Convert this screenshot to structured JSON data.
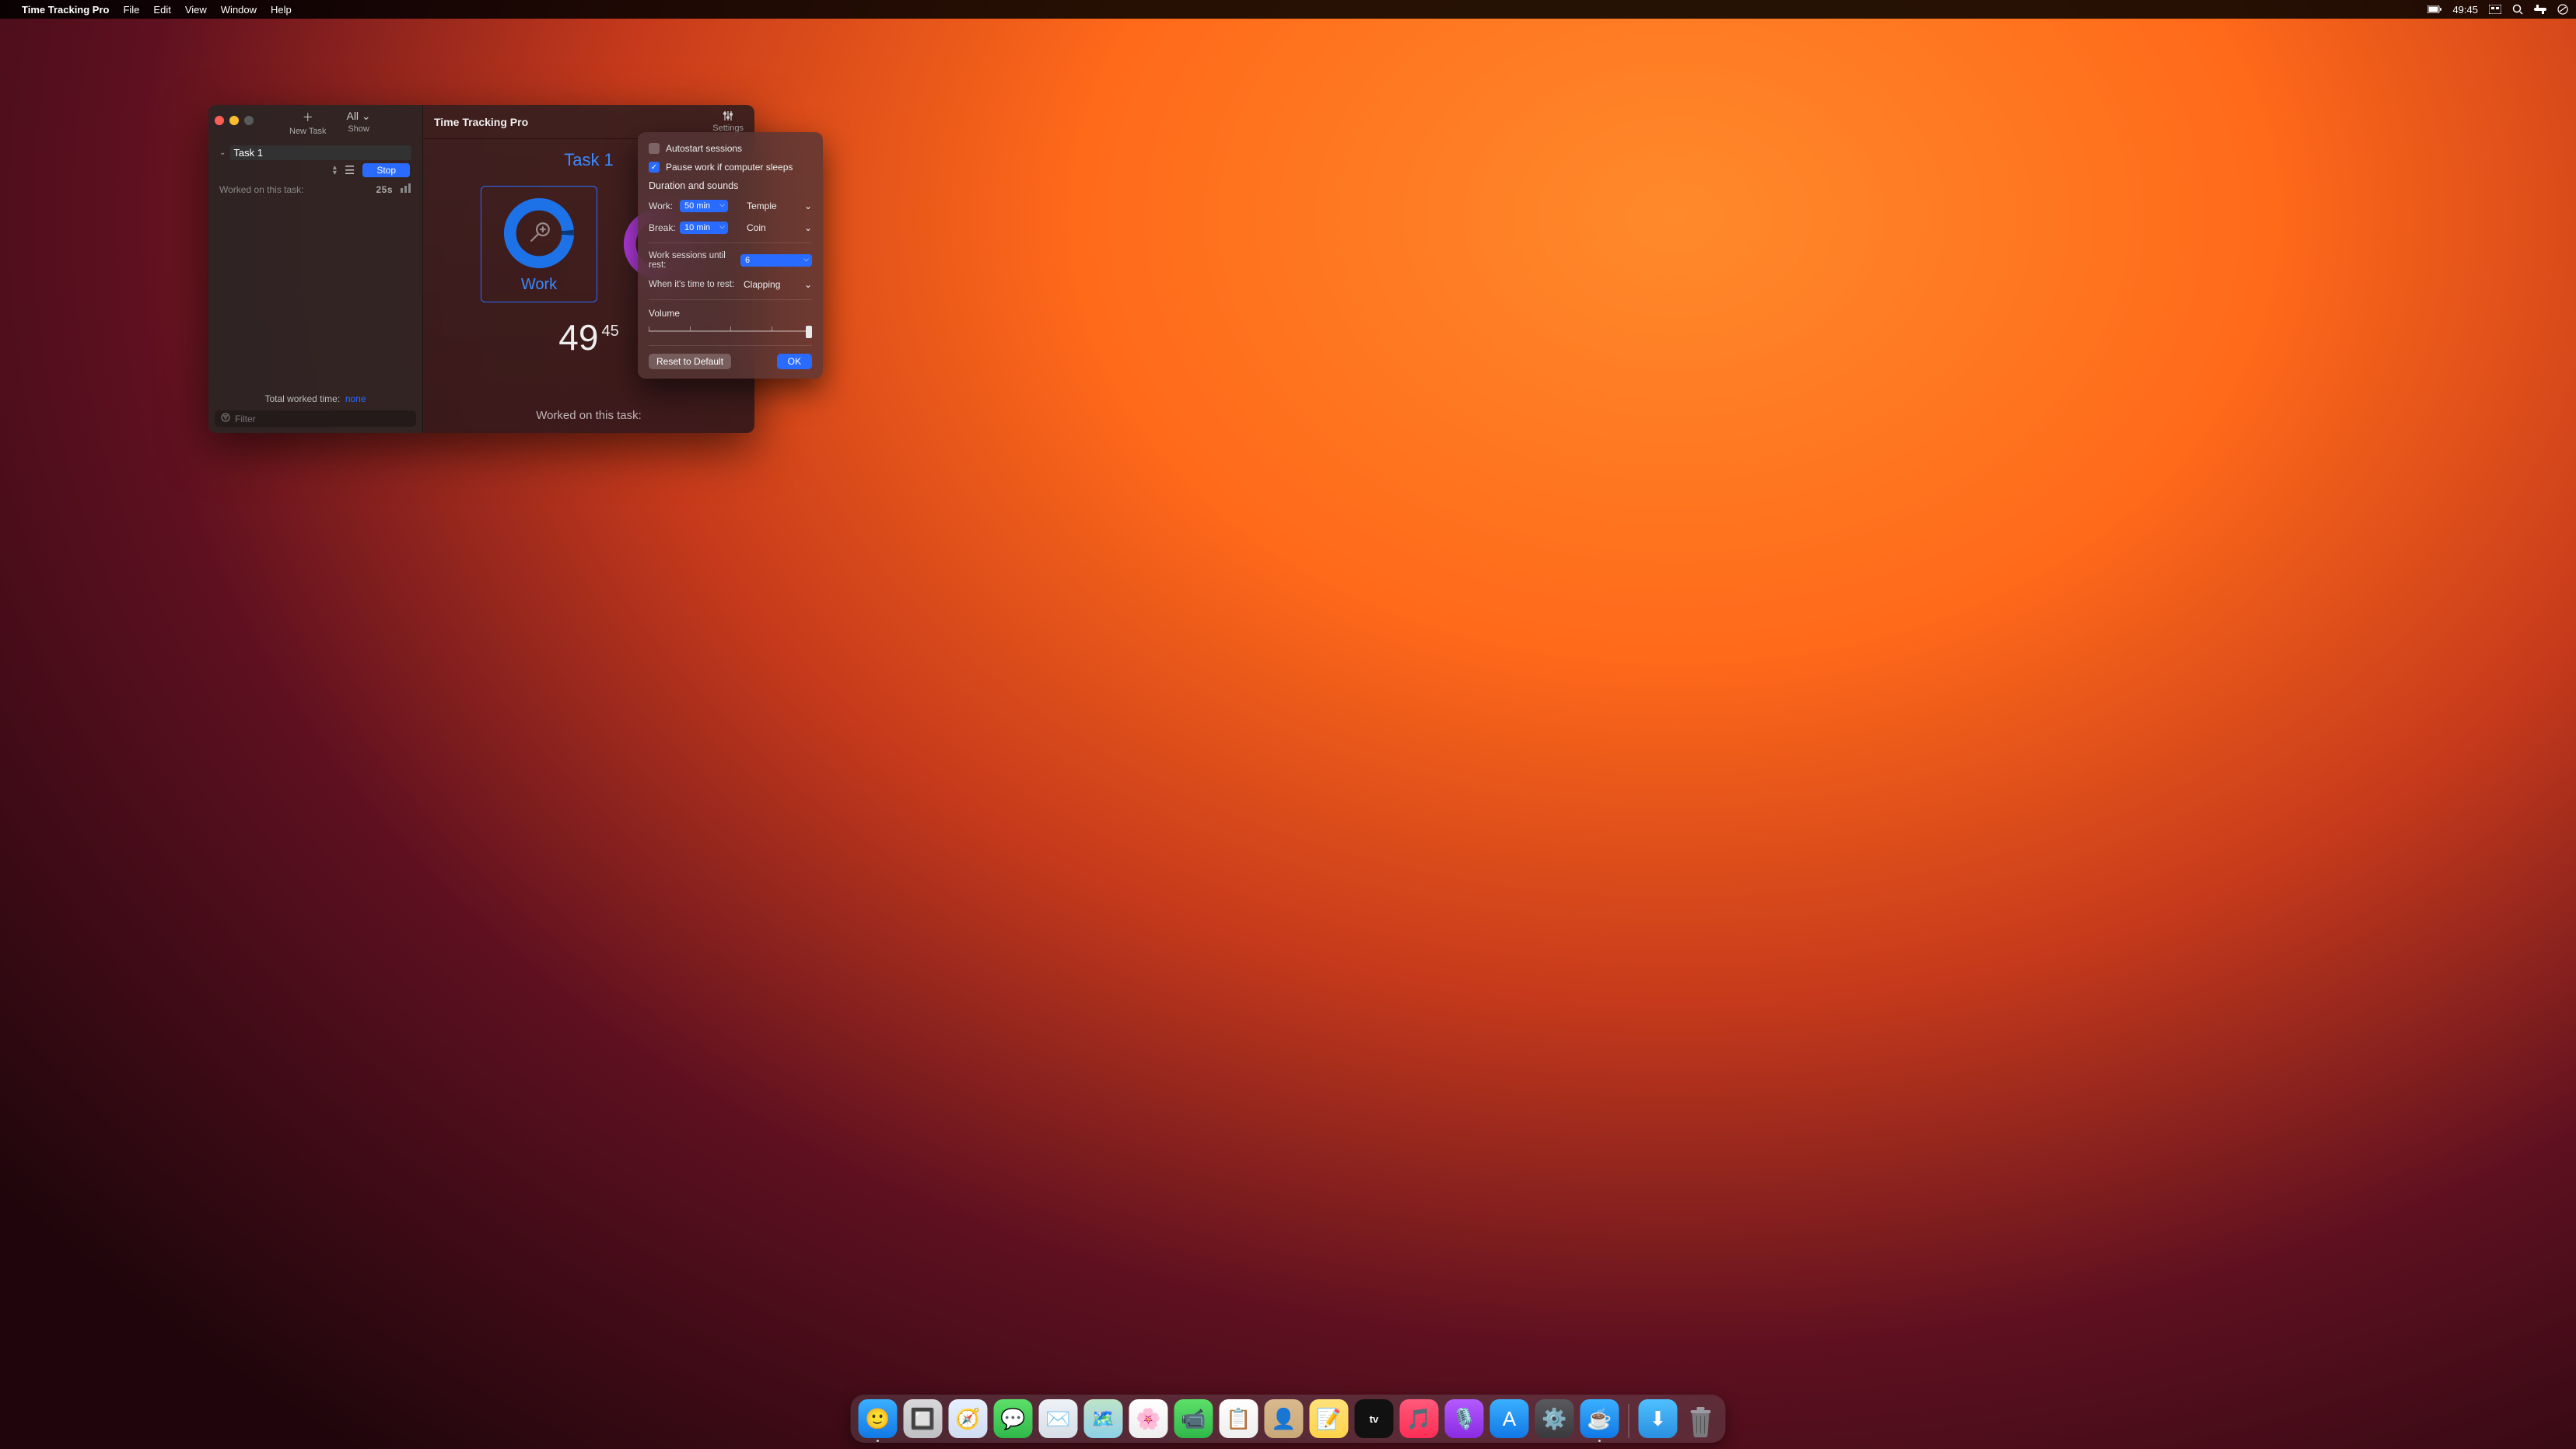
{
  "menubar": {
    "app": "Time Tracking Pro",
    "items": [
      "File",
      "Edit",
      "View",
      "Window",
      "Help"
    ],
    "clock": "49:45"
  },
  "window": {
    "toolbar": {
      "new_task_label": "New Task",
      "show_label": "Show",
      "show_value": "All"
    },
    "task": {
      "title": "Task 1",
      "stop_label": "Stop",
      "worked_prefix": "Worked on this task:",
      "worked_value": "25s"
    },
    "footer": {
      "total_prefix": "Total worked time:",
      "total_value": "none",
      "filter_placeholder": "Filter"
    },
    "detail": {
      "app_title": "Time Tracking Pro",
      "settings_label": "Settings",
      "task_heading": "Task 1",
      "ring_label": "Work",
      "timer_min": "49",
      "timer_sec": "45",
      "worked_line": "Worked on this task:"
    }
  },
  "popover": {
    "autostart_label": "Autostart sessions",
    "pause_label": "Pause work if computer sleeps",
    "pause_checked": true,
    "section": "Duration and sounds",
    "work_label": "Work:",
    "work_value": "50 min",
    "work_sound": "Temple",
    "break_label": "Break:",
    "break_value": "10 min",
    "break_sound": "Coin",
    "sessions_label": "Work sessions until rest:",
    "sessions_value": "6",
    "rest_label": "When it's time to rest:",
    "rest_value": "Clapping",
    "volume_label": "Volume",
    "reset_label": "Reset to Default",
    "ok_label": "OK"
  },
  "dock": {
    "apps": [
      {
        "name": "finder",
        "bg": "linear-gradient(#3ab0ff,#1178e6)",
        "glyph": "🙂"
      },
      {
        "name": "launchpad",
        "bg": "linear-gradient(#d8d8da,#bfbfc4)",
        "glyph": "🔲"
      },
      {
        "name": "safari",
        "bg": "linear-gradient(#e6f0ff,#d0dcf0)",
        "glyph": "🧭"
      },
      {
        "name": "messages",
        "bg": "linear-gradient(#5de06a,#2fb84a)",
        "glyph": "💬"
      },
      {
        "name": "mail",
        "bg": "linear-gradient(#eef2f7,#d6dde6)",
        "glyph": "✉️"
      },
      {
        "name": "maps",
        "bg": "linear-gradient(#bfe4c8,#8ed0e8)",
        "glyph": "🗺️"
      },
      {
        "name": "photos",
        "bg": "linear-gradient(#fff,#eee)",
        "glyph": "🌸"
      },
      {
        "name": "facetime",
        "bg": "linear-gradient(#5de06a,#2fb84a)",
        "glyph": "📹"
      },
      {
        "name": "reminders",
        "bg": "linear-gradient(#fff,#eee)",
        "glyph": "📋"
      },
      {
        "name": "contacts",
        "bg": "linear-gradient(#d9b98d,#c9a878)",
        "glyph": "👤"
      },
      {
        "name": "notes",
        "bg": "linear-gradient(#ffe27a,#ffd24a)",
        "glyph": "📝"
      },
      {
        "name": "tv",
        "bg": "#111",
        "glyph": "tv"
      },
      {
        "name": "music",
        "bg": "linear-gradient(#ff5a7a,#ff2d55)",
        "glyph": "🎵"
      },
      {
        "name": "podcasts",
        "bg": "linear-gradient(#b45aff,#8a2be2)",
        "glyph": "🎙️"
      },
      {
        "name": "appstore",
        "bg": "linear-gradient(#3ab0ff,#1178e6)",
        "glyph": "A"
      },
      {
        "name": "settings",
        "bg": "linear-gradient(#5a5a5e,#3a3a3e)",
        "glyph": "⚙️"
      },
      {
        "name": "timetracking",
        "bg": "linear-gradient(#3ab0ff,#1178e6)",
        "glyph": "☕"
      }
    ]
  }
}
